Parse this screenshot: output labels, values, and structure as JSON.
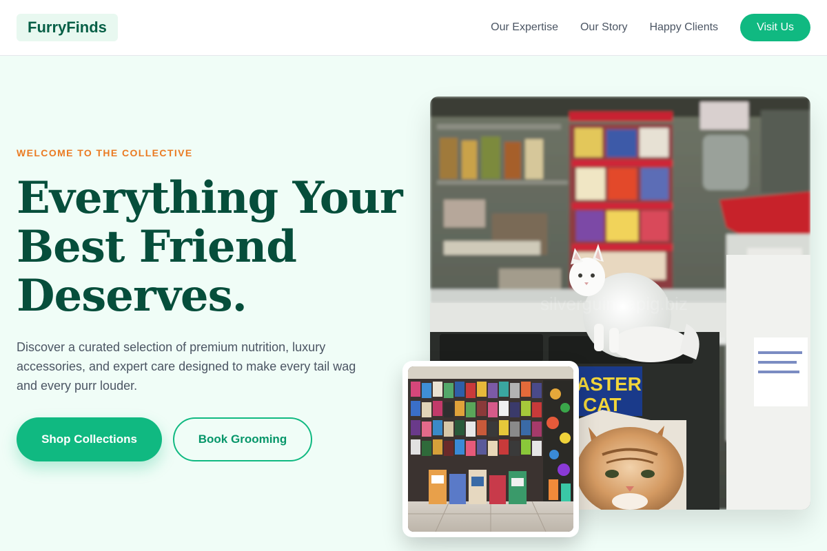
{
  "brand": {
    "name": "FurryFinds"
  },
  "nav": {
    "links": [
      "Our Expertise",
      "Our Story",
      "Happy Clients"
    ],
    "cta": "Visit Us"
  },
  "hero": {
    "eyebrow": "WELCOME TO THE COLLECTIVE",
    "headline_lines": [
      "Everything Your",
      "Best Friend",
      "Deserves."
    ],
    "lead": "Discover a curated selection of premium nutrition, luxury accessories, and expert care designed to make every tail wag and every purr louder.",
    "primary_cta": "Shop Collections",
    "secondary_cta": "Book Grooming"
  },
  "images": {
    "main_watermark": "silverguineapig.biz",
    "sign_text_1": "ASTER",
    "sign_text_2": "CAT"
  },
  "colors": {
    "accent": "#10b981",
    "accent_dark": "#064e3b",
    "eyebrow": "#ea7a22",
    "background": "#f0fdf7"
  }
}
